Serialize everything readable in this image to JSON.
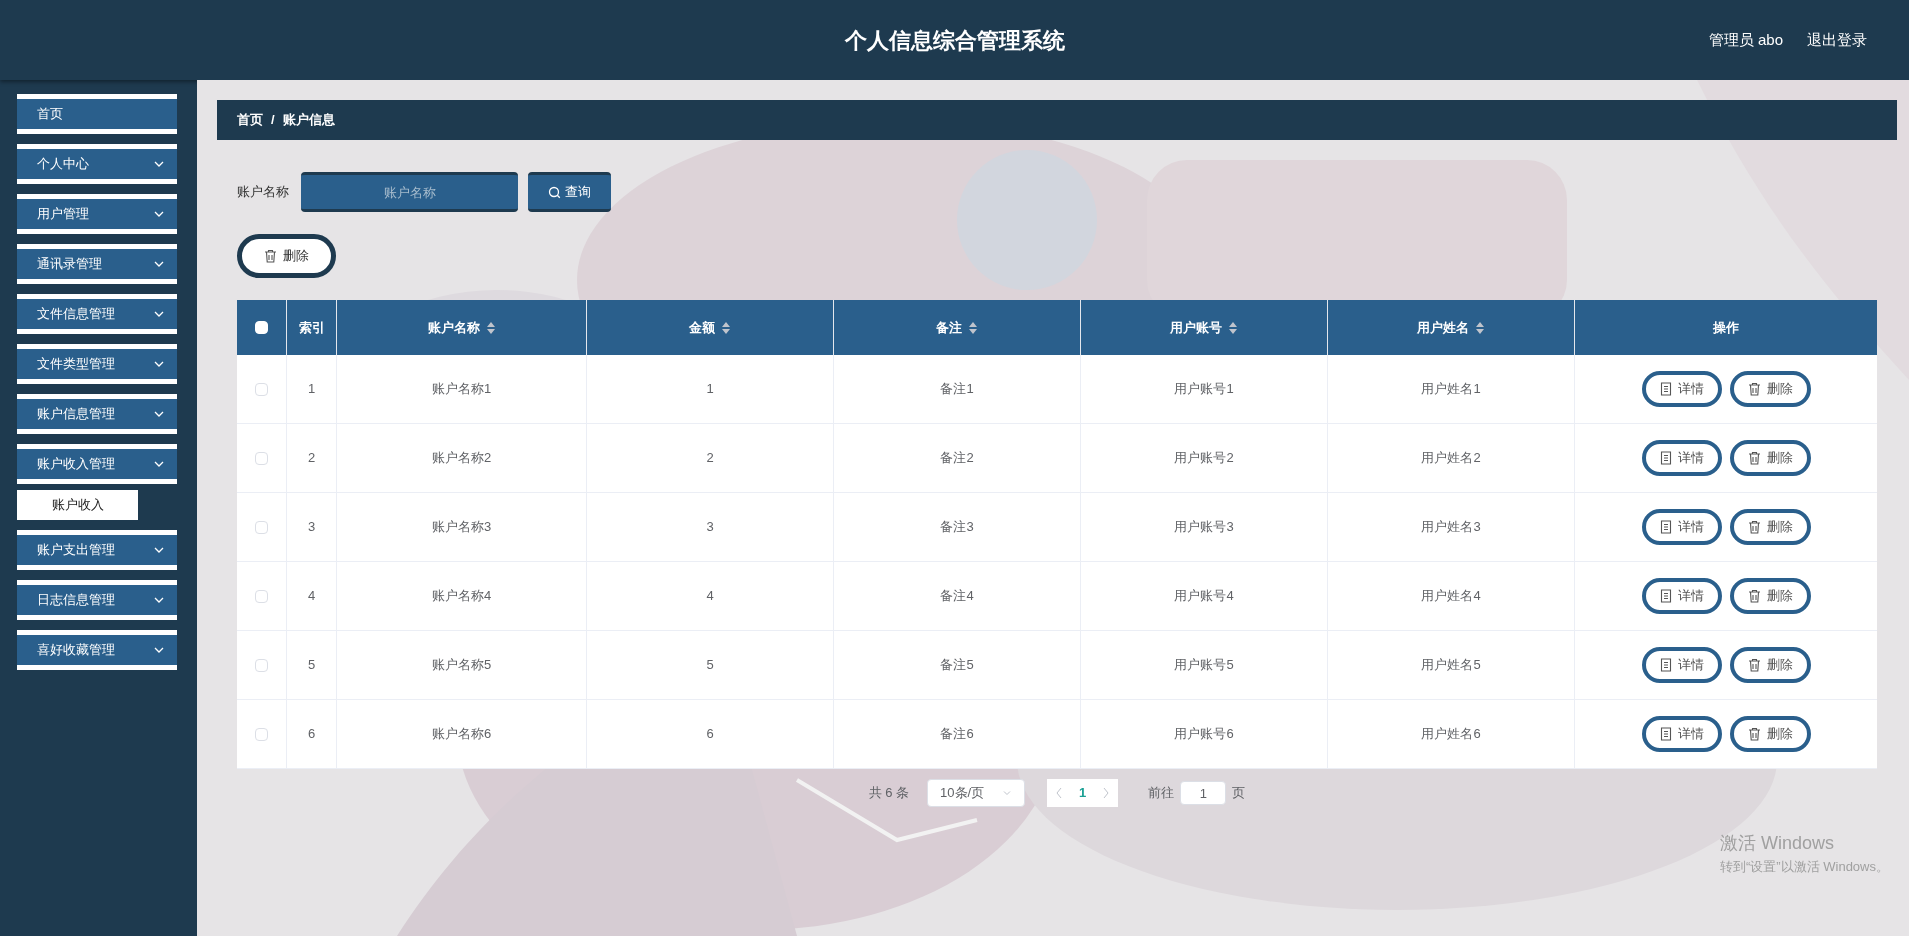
{
  "header": {
    "title": "个人信息综合管理系统",
    "user": "管理员 abo",
    "logout": "退出登录"
  },
  "sidebar": {
    "items": [
      {
        "label": "首页",
        "kind": "link"
      },
      {
        "label": "个人中心",
        "kind": "menu"
      },
      {
        "label": "用户管理",
        "kind": "menu"
      },
      {
        "label": "通讯录管理",
        "kind": "menu"
      },
      {
        "label": "文件信息管理",
        "kind": "menu"
      },
      {
        "label": "文件类型管理",
        "kind": "menu"
      },
      {
        "label": "账户信息管理",
        "kind": "menu"
      },
      {
        "label": "账户收入管理",
        "kind": "menu",
        "children": [
          {
            "label": "账户收入"
          }
        ]
      },
      {
        "label": "账户支出管理",
        "kind": "menu"
      },
      {
        "label": "日志信息管理",
        "kind": "menu"
      },
      {
        "label": "喜好收藏管理",
        "kind": "menu"
      }
    ]
  },
  "breadcrumb": [
    "首页",
    "/",
    "账户信息"
  ],
  "search": {
    "label": "账户名称",
    "placeholder": "账户名称",
    "button": "查询"
  },
  "delete_button": "删除",
  "table": {
    "select_all_checked": false,
    "columns": [
      {
        "label": "索引",
        "sortable": false
      },
      {
        "label": "账户名称",
        "sortable": true
      },
      {
        "label": "金额",
        "sortable": true
      },
      {
        "label": "备注",
        "sortable": true
      },
      {
        "label": "用户账号",
        "sortable": true
      },
      {
        "label": "用户姓名",
        "sortable": true
      },
      {
        "label": "操作",
        "sortable": false
      }
    ],
    "rows": [
      {
        "checked": false,
        "cells": [
          "1",
          "账户名称1",
          "1",
          "备注1",
          "用户账号1",
          "用户姓名1"
        ],
        "actions": [
          "详情",
          "删除"
        ]
      },
      {
        "checked": false,
        "cells": [
          "2",
          "账户名称2",
          "2",
          "备注2",
          "用户账号2",
          "用户姓名2"
        ],
        "actions": [
          "详情",
          "删除"
        ]
      },
      {
        "checked": false,
        "cells": [
          "3",
          "账户名称3",
          "3",
          "备注3",
          "用户账号3",
          "用户姓名3"
        ],
        "actions": [
          "详情",
          "删除"
        ]
      },
      {
        "checked": false,
        "cells": [
          "4",
          "账户名称4",
          "4",
          "备注4",
          "用户账号4",
          "用户姓名4"
        ],
        "actions": [
          "详情",
          "删除"
        ]
      },
      {
        "checked": false,
        "cells": [
          "5",
          "账户名称5",
          "5",
          "备注5",
          "用户账号5",
          "用户姓名5"
        ],
        "actions": [
          "详情",
          "删除"
        ]
      },
      {
        "checked": false,
        "cells": [
          "6",
          "账户名称6",
          "6",
          "备注6",
          "用户账号6",
          "用户姓名6"
        ],
        "actions": [
          "详情",
          "删除"
        ]
      }
    ]
  },
  "pagination": {
    "total": "共 6 条",
    "page_size": "10条/页",
    "pages": [
      {
        "label": "1",
        "selected": true
      }
    ],
    "goto_label": "前往",
    "goto_value": "1",
    "goto_suffix": "页"
  },
  "windows_notice": {
    "title": "激活 Windows",
    "text": "转到“设置”以激活 Windows。"
  }
}
